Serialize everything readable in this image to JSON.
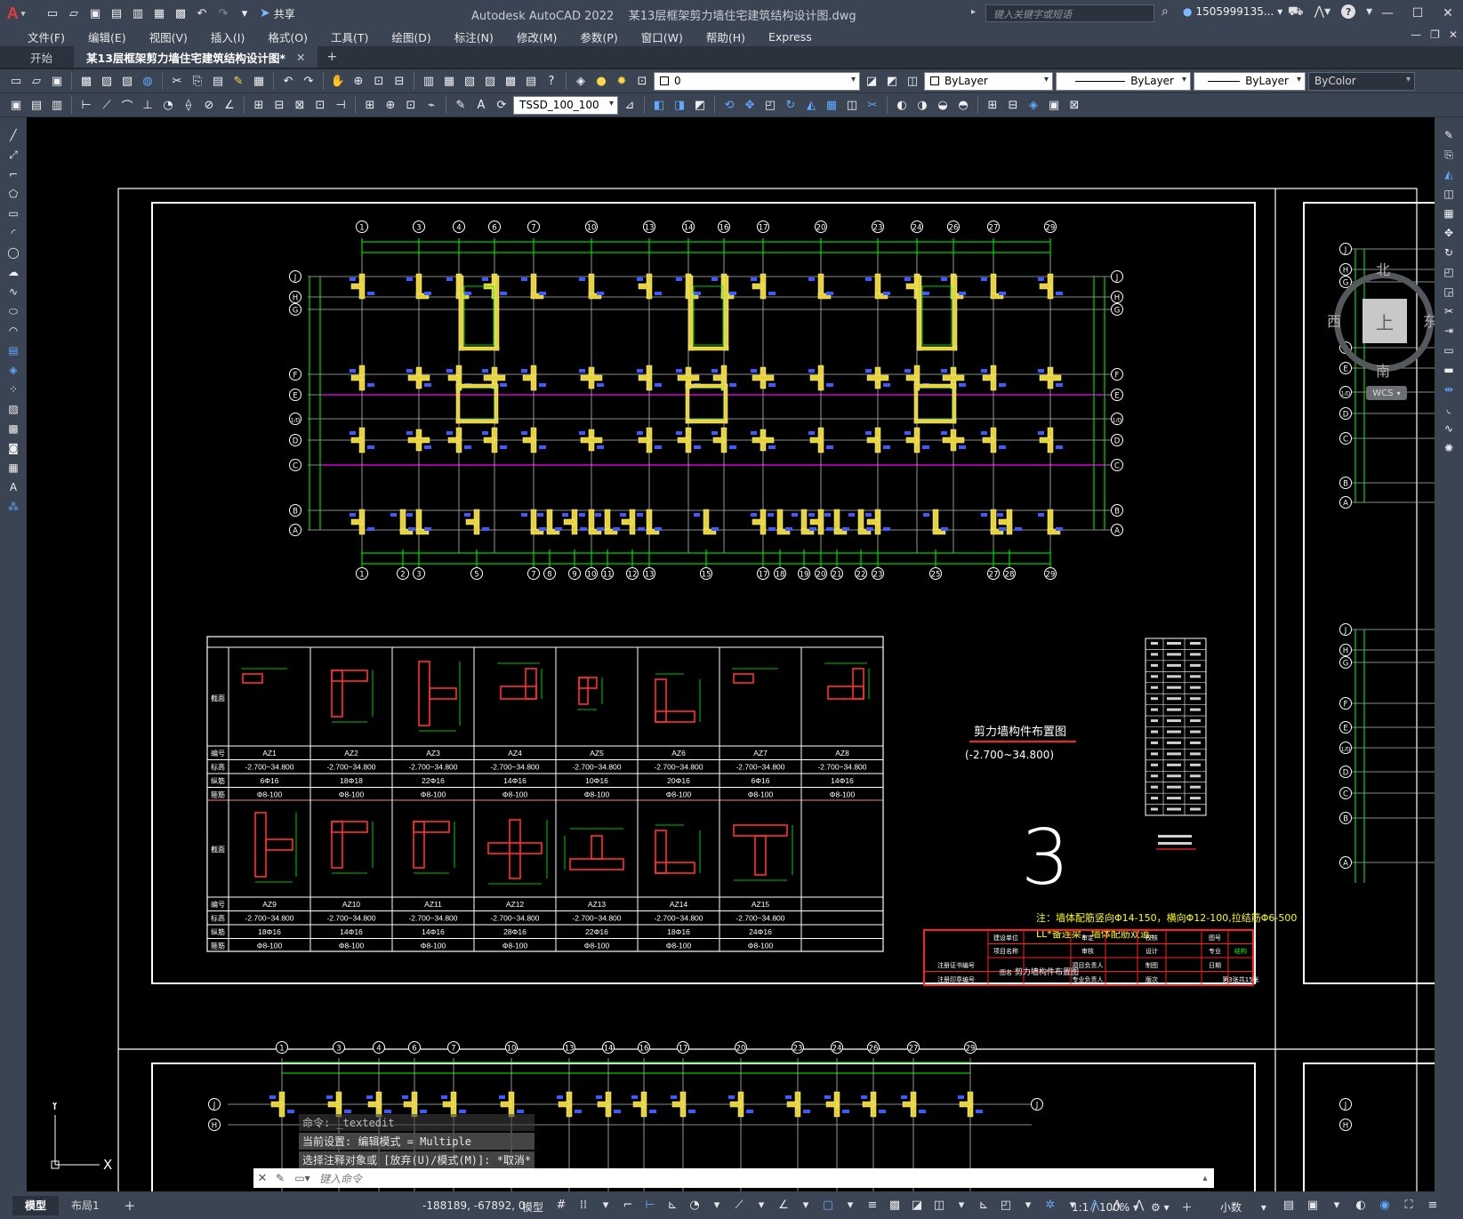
{
  "title_bar": {
    "app_logo": "A",
    "app_title": "Autodesk AutoCAD 2022",
    "file_title": "某13层框架剪力墙住宅建筑结构设计图.dwg",
    "share_label": "共享",
    "search_placeholder": "键入关键字或短语",
    "user_name": "1505999135...",
    "help_icon": "?"
  },
  "menu": {
    "items": [
      "文件(F)",
      "编辑(E)",
      "视图(V)",
      "插入(I)",
      "格式(O)",
      "工具(T)",
      "绘图(D)",
      "标注(N)",
      "修改(M)",
      "参数(P)",
      "窗口(W)",
      "帮助(H)",
      "Express"
    ]
  },
  "file_tabs": {
    "start_label": "开始",
    "active_label": "某13层框架剪力墙住宅建筑结构设计图*"
  },
  "toolbars": {
    "layer_name": "0",
    "color": "ByLayer",
    "linetype": "ByLayer",
    "lineweight": "ByLayer",
    "plotstyle": "ByColor",
    "dim_style": "TSSD_100_100"
  },
  "viewcube": {
    "north": "北",
    "south": "南",
    "east": "东",
    "west": "西",
    "face": "上",
    "wcs": "WCS"
  },
  "drawing": {
    "plan_title": "剪力墙构件布置图",
    "plan_elevation": "(-2.700~34.800)",
    "sheet_number": "3",
    "note_line1": "注：墙体配筋竖向Φ14-150，横向Φ12-100,拉结筋Φ6-500",
    "note_line2": "LL*备连梁，墙体配筋双道。",
    "top_axes": [
      "1",
      "3",
      "4",
      "6",
      "7",
      "10",
      "13",
      "14",
      "16",
      "17",
      "20",
      "23",
      "24",
      "26",
      "27",
      "29"
    ],
    "bottom_axes": [
      "1",
      "2",
      "3",
      "5",
      "7",
      "8",
      "9",
      "10",
      "11",
      "12",
      "13",
      "15",
      "17",
      "18",
      "19",
      "20",
      "21",
      "22",
      "23",
      "25",
      "27",
      "28",
      "29"
    ],
    "row_axes": [
      "J",
      "H",
      "G",
      "F",
      "E",
      "1/D",
      "D",
      "C",
      "B",
      "A"
    ],
    "table_row1": {
      "codes": [
        "AZ1",
        "AZ2",
        "AZ3",
        "AZ4",
        "AZ5",
        "AZ6",
        "AZ7",
        "AZ8"
      ],
      "elevations": [
        "-2.700~34.800",
        "-2.700~34.800",
        "-2.700~34.800",
        "-2.700~34.800",
        "-2.700~34.800",
        "-2.700~34.800",
        "-2.700~34.800",
        "-2.700~34.800"
      ],
      "longitudinal": [
        "6Φ16",
        "18Φ18",
        "22Φ16",
        "14Φ16",
        "10Φ16",
        "20Φ16",
        "6Φ16",
        "14Φ16"
      ],
      "stirrups": [
        "Φ8-100",
        "Φ8-100",
        "Φ8-100",
        "Φ8-100",
        "Φ8-100",
        "Φ8-100",
        "Φ8-100",
        "Φ8-100"
      ]
    },
    "table_row2": {
      "codes": [
        "AZ9",
        "AZ10",
        "AZ11",
        "AZ12",
        "AZ13",
        "AZ14",
        "AZ15"
      ],
      "elevations": [
        "-2.700~34.800",
        "-2.700~34.800",
        "-2.700~34.800",
        "-2.700~34.800",
        "-2.700~34.800",
        "-2.700~34.800",
        "-2.700~34.800"
      ],
      "longitudinal": [
        "18Φ16",
        "14Φ16",
        "14Φ16",
        "28Φ16",
        "22Φ16",
        "18Φ16",
        "24Φ16"
      ],
      "stirrups": [
        "Φ8-100",
        "Φ8-100",
        "Φ8-100",
        "Φ8-100",
        "Φ8-100",
        "Φ8-100",
        "Φ8-100"
      ]
    },
    "table_header_labels": [
      "截面",
      "编号",
      "标高",
      "纵筋",
      "箍筋"
    ],
    "title_block": {
      "drawing_name": "剪力墙构件布置图",
      "cells": [
        "建设单位",
        "项目名称",
        "审定",
        "校核",
        "图号",
        "审核",
        "设计",
        "专业",
        "结构",
        "项目负责人",
        "制图",
        "日期",
        "注册证书编号",
        "注册印章编号",
        "图名",
        "专业负责人",
        "版次",
        "第3张共15张"
      ]
    }
  },
  "command": {
    "history": [
      "命令: _textedit",
      "当前设置: 编辑模式 = Multiple",
      "选择注释对象或 [放弃(U)/模式(M)]: *取消*"
    ],
    "input_placeholder": "键入命令"
  },
  "status": {
    "tab_model": "模型",
    "tab_layout": "布局1",
    "coords": "-188189, -67892, 0",
    "mode": "模型",
    "scale": "1:1 / 100%",
    "units": "小数"
  },
  "colors": {
    "chrome": "#3b4453",
    "canvas": "#000000",
    "grid_green": "#00ff00",
    "wall_yellow": "#e6d23c",
    "axis_magenta": "#ff00ff",
    "label_blue": "#3c5cff",
    "title_red": "#ff2020",
    "note_yellow": "#ffff00"
  }
}
